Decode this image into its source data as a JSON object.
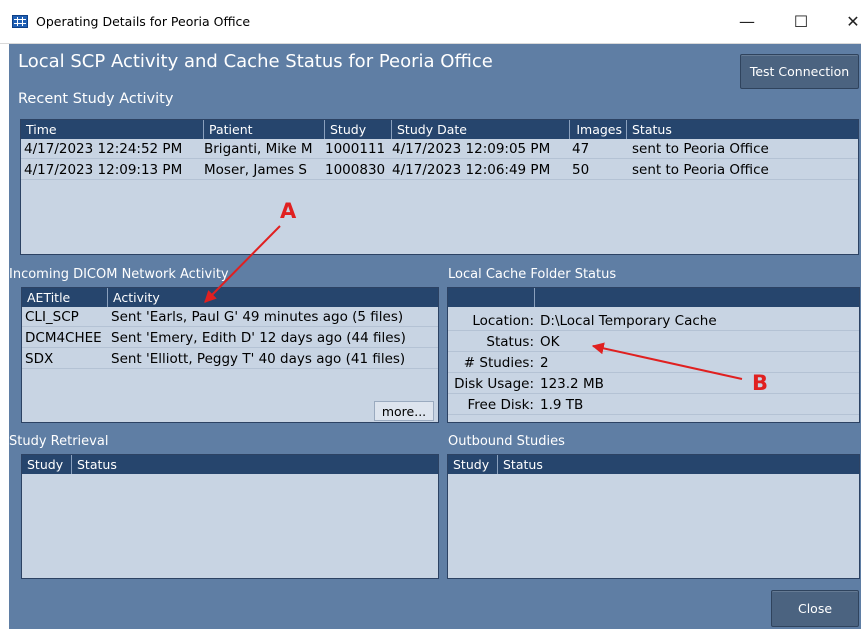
{
  "window": {
    "title": "Operating Details for Peoria Office",
    "minimize_glyph": "—",
    "maximize_glyph": "☐",
    "close_glyph": "✕"
  },
  "dialog": {
    "title": "Local SCP Activity and Cache Status for Peoria Office",
    "test_connection_label": "Test Connection",
    "close_label": "Close"
  },
  "recent_activity": {
    "title": "Recent Study Activity",
    "columns": [
      "Time",
      "Patient",
      "Study",
      "Study Date",
      "Images",
      "Status"
    ],
    "rows": [
      [
        "4/17/2023 12:24:52 PM",
        "Briganti, Mike M",
        "1000111",
        "4/17/2023 12:09:05 PM",
        "47",
        "sent to Peoria Office"
      ],
      [
        "4/17/2023 12:09:13 PM",
        "Moser, James S",
        "1000830",
        "4/17/2023 12:06:49 PM",
        "50",
        "sent to Peoria Office"
      ]
    ]
  },
  "incoming": {
    "title": "Incoming DICOM Network Activity",
    "columns": [
      "AETitle",
      "Activity"
    ],
    "rows": [
      [
        "CLI_SCP",
        "Sent 'Earls, Paul G' 49 minutes ago (5 files)"
      ],
      [
        "DCM4CHEE",
        "Sent 'Emery, Edith D' 12 days ago (44 files)"
      ],
      [
        "SDX",
        "Sent 'Elliott, Peggy T' 40 days ago (41 files)"
      ]
    ],
    "more_label": "more..."
  },
  "cache": {
    "title": "Local Cache Folder Status",
    "rows": [
      [
        "Location:",
        "D:\\Local Temporary Cache"
      ],
      [
        "Status:",
        "OK"
      ],
      [
        "# Studies:",
        "2"
      ],
      [
        "Disk Usage:",
        "123.2 MB"
      ],
      [
        "Free Disk:",
        "1.9 TB"
      ]
    ]
  },
  "retrieval": {
    "title": "Study Retrieval",
    "columns": [
      "Study",
      "Status"
    ]
  },
  "outbound": {
    "title": "Outbound Studies",
    "columns": [
      "Study",
      "Status"
    ]
  },
  "annotations": {
    "a_label": "A",
    "b_label": "B",
    "color": "#e02020"
  },
  "colors": {
    "dialog_bg": "#5f7ea4",
    "header_bg": "#26456d",
    "panel_bg": "#c8d4e3"
  }
}
